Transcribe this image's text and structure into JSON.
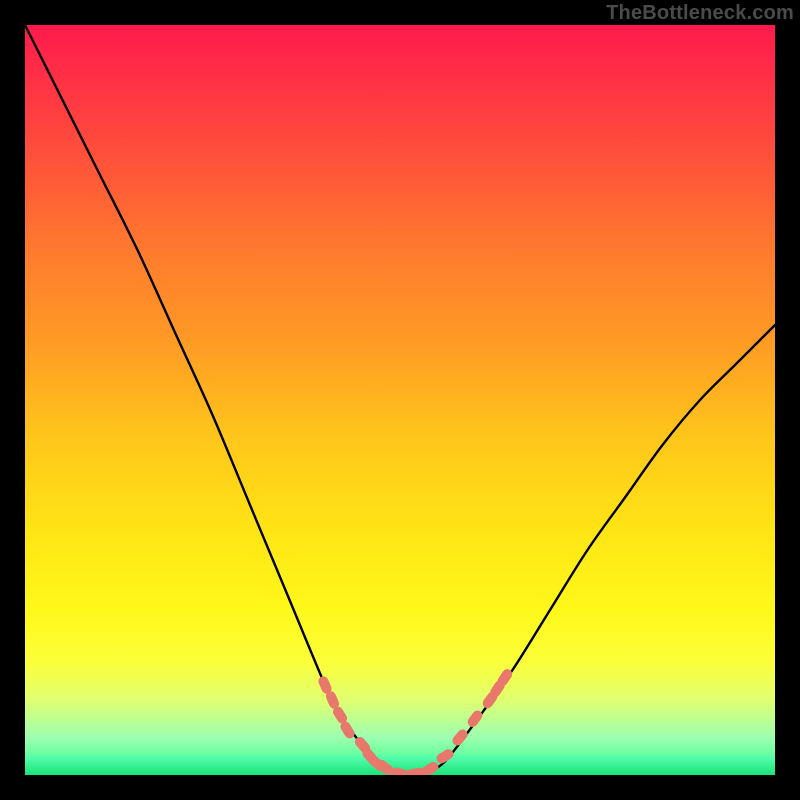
{
  "attribution": "TheBottleneck.com",
  "colors": {
    "frame": "#000000",
    "curve": "#000000",
    "marker": "#e7786b",
    "gradient_top": "#ff1a4d",
    "gradient_bottom": "#2eff88"
  },
  "chart_data": {
    "type": "line",
    "title": "",
    "xlabel": "",
    "ylabel": "",
    "xlim": [
      0,
      100
    ],
    "ylim": [
      0,
      100
    ],
    "axes_visible": false,
    "grid": false,
    "background": "rainbow vertical gradient (red top → green bottom)",
    "series": [
      {
        "name": "bottleneck-curve",
        "x": [
          0,
          5,
          10,
          15,
          20,
          25,
          30,
          35,
          40,
          42,
          45,
          48,
          50,
          52,
          55,
          57,
          60,
          65,
          70,
          75,
          80,
          85,
          90,
          95,
          100
        ],
        "y": [
          100,
          90,
          80,
          70,
          59,
          48,
          36,
          24,
          12,
          8,
          4,
          1,
          0,
          0,
          1,
          3,
          7,
          14,
          22,
          30,
          37,
          44,
          50,
          55,
          60
        ],
        "style": "smooth black curve"
      }
    ],
    "markers": {
      "name": "highlighted-points",
      "color": "#e7786b",
      "shape": "rounded-dash",
      "points": [
        {
          "x": 40,
          "y": 12
        },
        {
          "x": 41,
          "y": 10
        },
        {
          "x": 42,
          "y": 8
        },
        {
          "x": 43,
          "y": 6
        },
        {
          "x": 45,
          "y": 4
        },
        {
          "x": 46,
          "y": 2.5
        },
        {
          "x": 47,
          "y": 1.5
        },
        {
          "x": 48,
          "y": 1
        },
        {
          "x": 50,
          "y": 0.2
        },
        {
          "x": 52,
          "y": 0.2
        },
        {
          "x": 54,
          "y": 0.8
        },
        {
          "x": 56,
          "y": 2.5
        },
        {
          "x": 58,
          "y": 5
        },
        {
          "x": 60,
          "y": 7.5
        },
        {
          "x": 62,
          "y": 10
        },
        {
          "x": 63,
          "y": 11.5
        },
        {
          "x": 64,
          "y": 13
        }
      ]
    },
    "notes": "V-shaped bottleneck curve; minimum (optimal match) around x≈50–52 where y≈0. Left branch starts at (0,100), right branch reaches ≈(100,60). Coral dashed markers highlight the near-zero valley region roughly x∈[40,64]."
  }
}
